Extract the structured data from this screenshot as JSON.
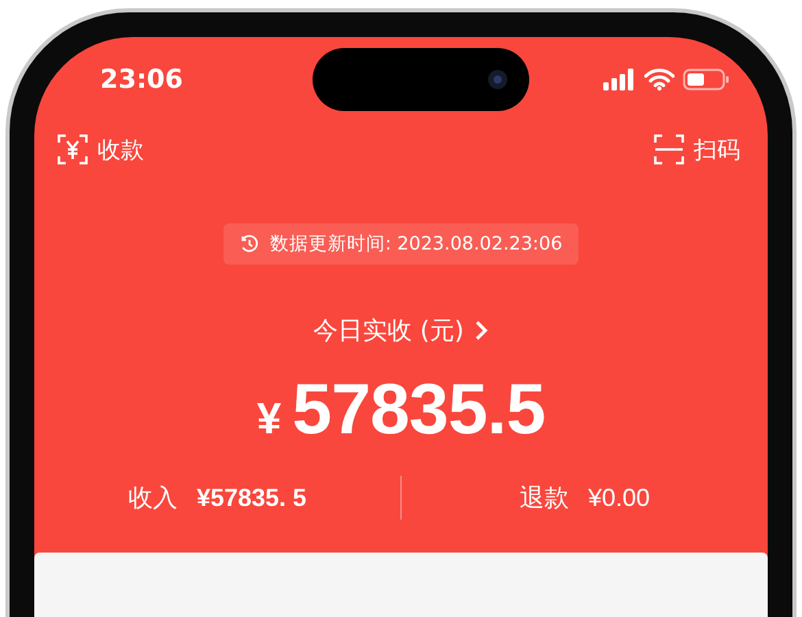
{
  "status_bar": {
    "time": "23:06"
  },
  "header": {
    "left_action": {
      "label": "收款"
    },
    "right_action": {
      "label": "扫码"
    }
  },
  "update_notice": {
    "label": "数据更新时间: 2023.08.02.23:06"
  },
  "summary": {
    "title": "今日实收 (元)",
    "currency": "¥",
    "amount": "57835.5"
  },
  "stats": [
    {
      "label": "收入",
      "value": "¥57835. 5"
    },
    {
      "label": "退款",
      "value": "¥0.00"
    }
  ]
}
